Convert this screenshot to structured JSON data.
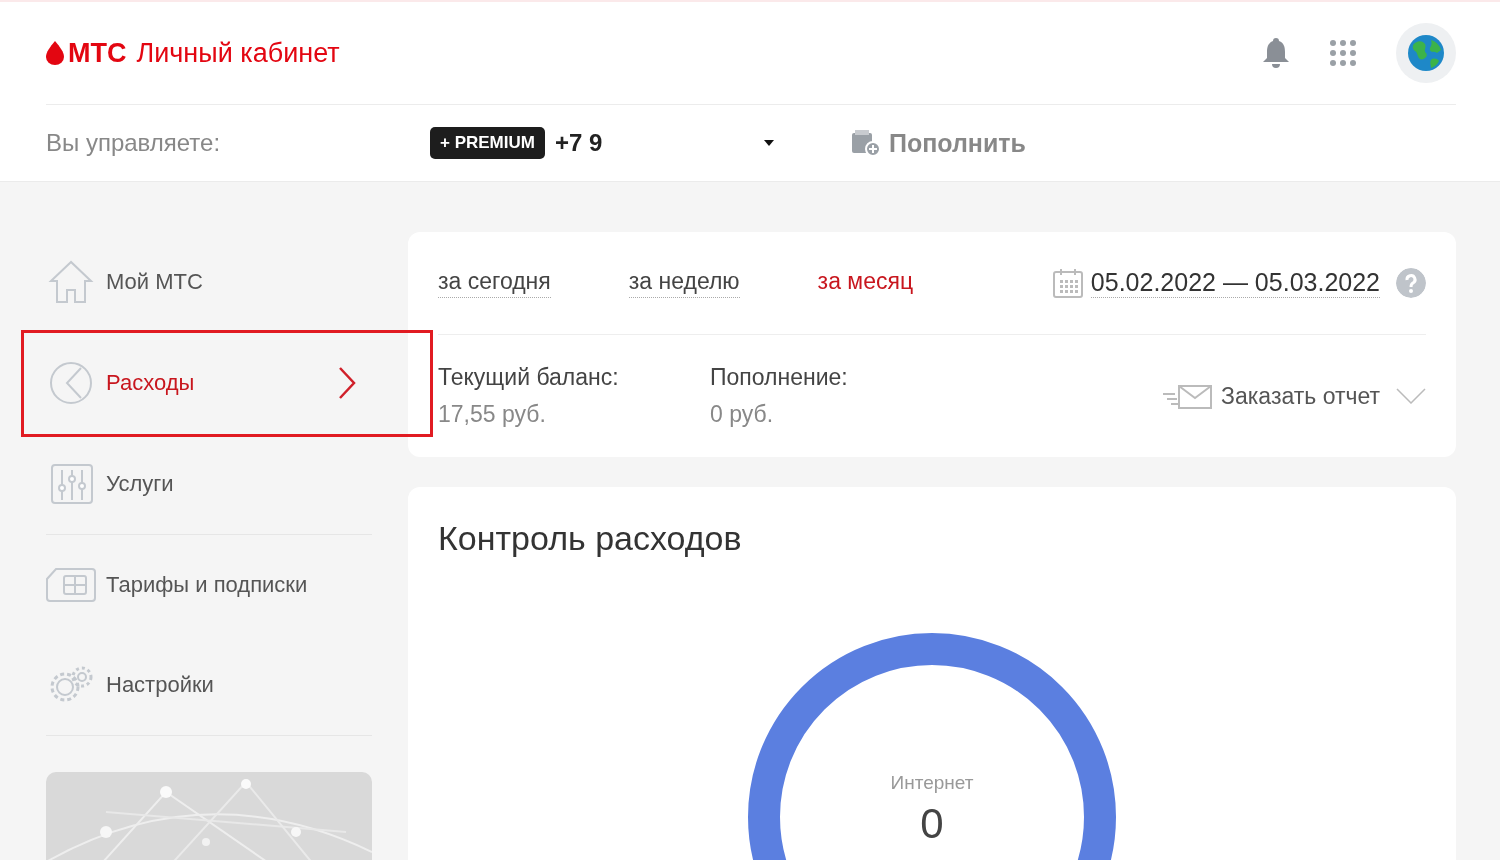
{
  "header": {
    "logo": "МТС",
    "title": "Личный кабинет"
  },
  "account_bar": {
    "label": "Вы управляете:",
    "badge": "+ PREMIUM",
    "phone": "+7 9",
    "topup": "Пополнить"
  },
  "sidebar": {
    "items": [
      {
        "label": "Мой МТС",
        "selected": false,
        "highlighted": false
      },
      {
        "label": "Расходы",
        "selected": true,
        "highlighted": true
      },
      {
        "label": "Услуги",
        "selected": false,
        "highlighted": false
      },
      {
        "label": "Тарифы и подписки",
        "selected": false,
        "highlighted": false
      },
      {
        "label": "Настройки",
        "selected": false,
        "highlighted": false
      }
    ]
  },
  "period_card": {
    "periods": [
      {
        "label": "за сегодня",
        "selected": false
      },
      {
        "label": "за неделю",
        "selected": false
      },
      {
        "label": "за месяц",
        "selected": true
      }
    ],
    "date_range": "05.02.2022 — 05.03.2022",
    "balance": {
      "label": "Текущий баланс:",
      "value": "17,55 руб."
    },
    "topups": {
      "label": "Пополнение:",
      "value": "0 руб."
    },
    "report_button": "Заказать отчет"
  },
  "control_card": {
    "title": "Контроль расходов",
    "donut": {
      "label": "Интернет",
      "value": "0"
    }
  }
}
